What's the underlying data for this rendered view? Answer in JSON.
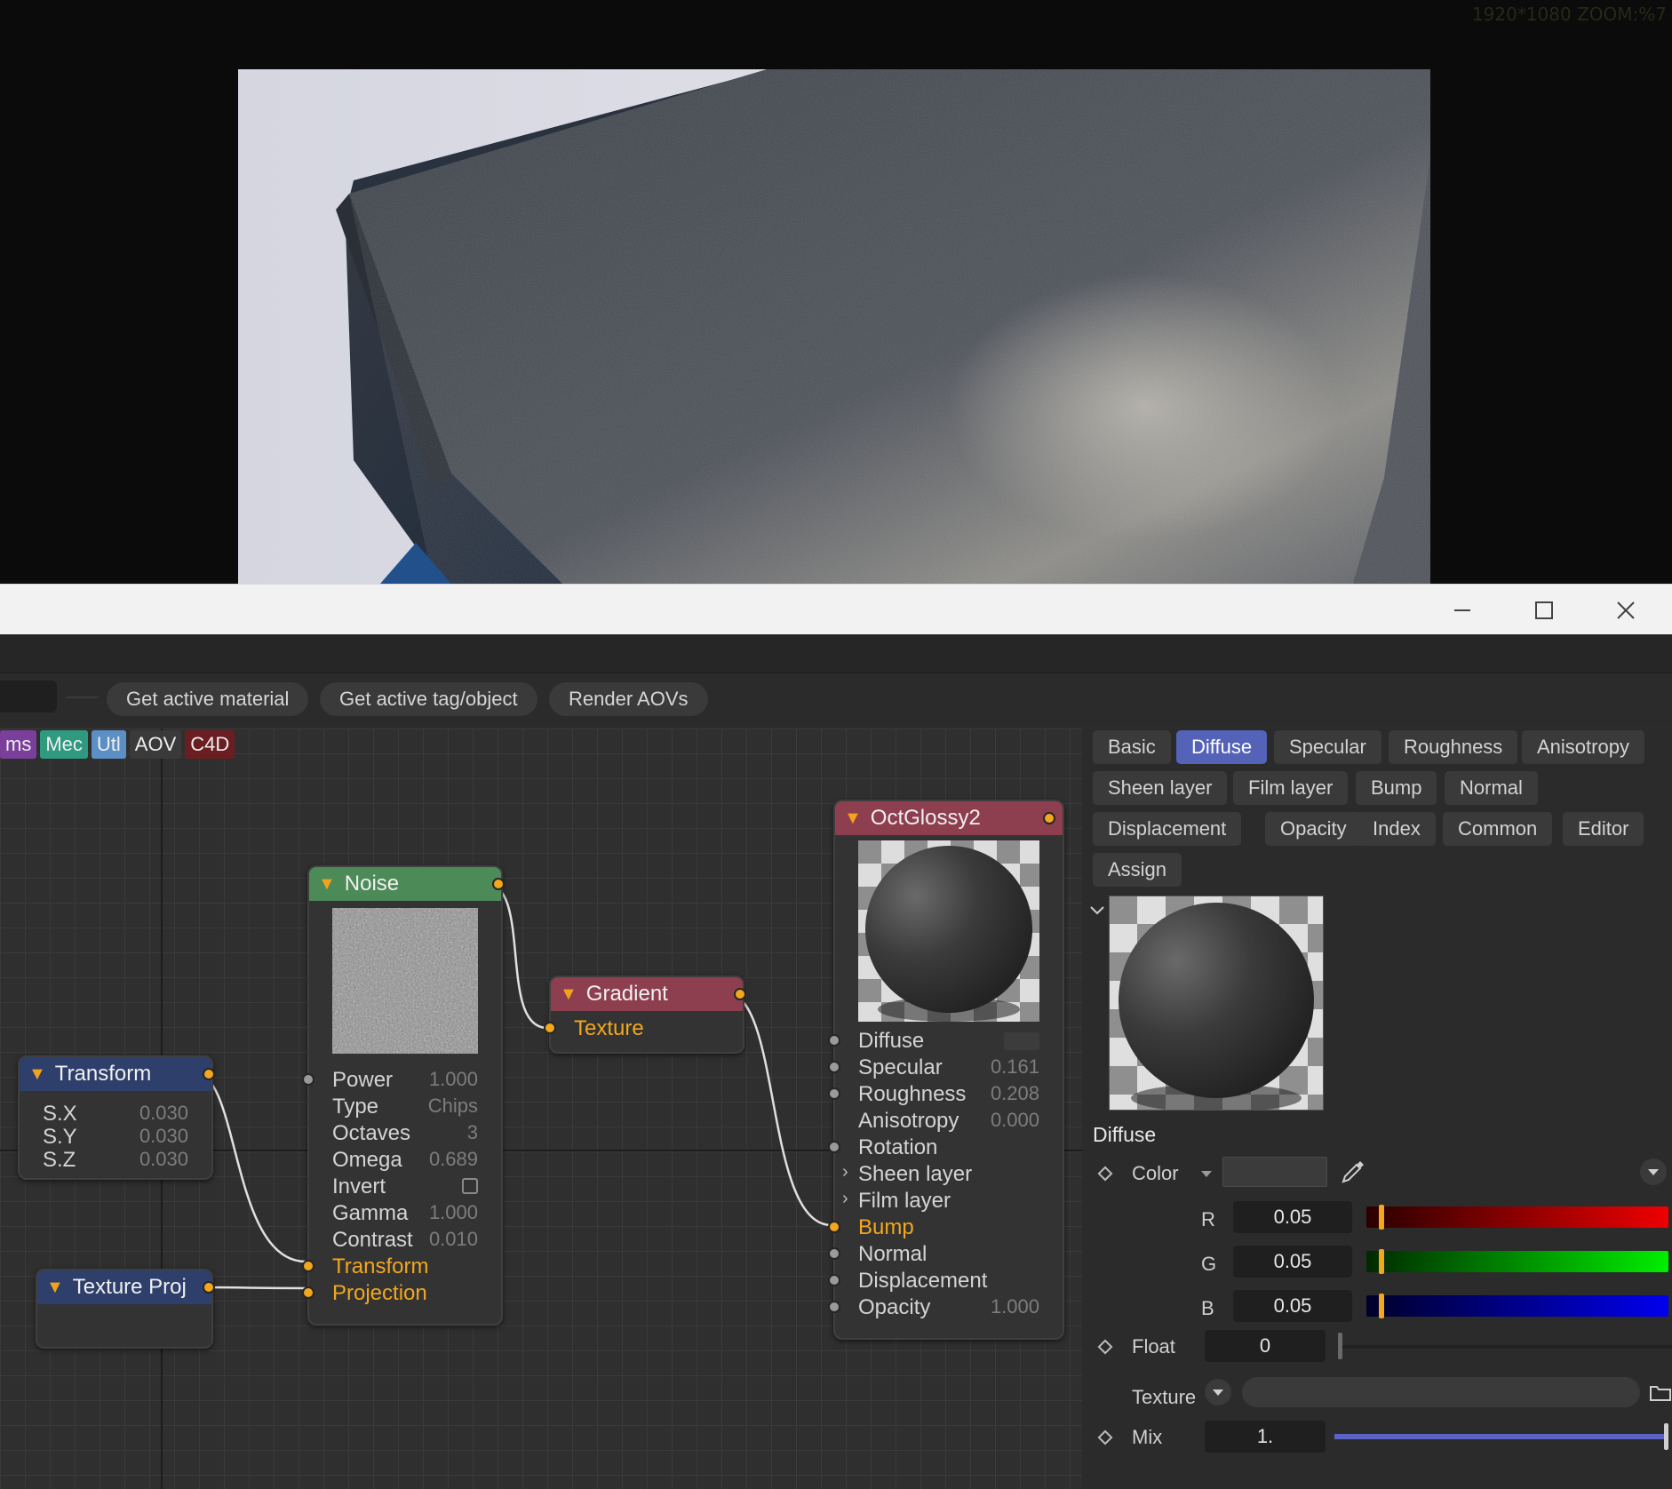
{
  "viewport": {
    "zoom_label": "1920*1080 ZOOM:%7"
  },
  "window": {
    "minimize": "—",
    "maximize": "☐",
    "close": "✕"
  },
  "toolbar": {
    "get_active_material": "Get active material",
    "get_active_tag": "Get active tag/object",
    "render_aovs": "Render AOVs"
  },
  "category_tags": [
    {
      "label": "ms",
      "color": "#7a3f9a"
    },
    {
      "label": "Mec",
      "color": "#2f9a80"
    },
    {
      "label": "Utl",
      "color": "#5c8fc4"
    },
    {
      "label": "AOV",
      "color": "#3a3a3a"
    },
    {
      "label": "C4D",
      "color": "#6b1e22"
    }
  ],
  "nodes": {
    "transform": {
      "title": "Transform",
      "color": "#2e3f6b",
      "params": [
        {
          "label": "S.X",
          "value": "0.030"
        },
        {
          "label": "S.Y",
          "value": "0.030"
        },
        {
          "label": "S.Z",
          "value": "0.030"
        }
      ]
    },
    "texture_proj": {
      "title": "Texture Proj",
      "color": "#2e3f6b"
    },
    "noise": {
      "title": "Noise",
      "color": "#4c8b57",
      "params": [
        {
          "label": "Power",
          "value": "1.000"
        },
        {
          "label": "Type",
          "value": "Chips"
        },
        {
          "label": "Octaves",
          "value": "3"
        },
        {
          "label": "Omega",
          "value": "0.689"
        },
        {
          "label": "Invert",
          "value": ""
        },
        {
          "label": "Gamma",
          "value": "1.000"
        },
        {
          "label": "Contrast",
          "value": "0.010"
        }
      ],
      "inputs": [
        "Transform",
        "Projection"
      ]
    },
    "gradient": {
      "title": "Gradient",
      "color": "#8e3f4f",
      "input": "Texture"
    },
    "octglossy": {
      "title": "OctGlossy2",
      "color": "#8e3f4f",
      "params": [
        {
          "label": "Diffuse",
          "value": ""
        },
        {
          "label": "Specular",
          "value": "0.161"
        },
        {
          "label": "Roughness",
          "value": "0.208"
        },
        {
          "label": "Anisotropy",
          "value": "0.000"
        },
        {
          "label": "Rotation",
          "value": ""
        },
        {
          "label": "Sheen layer",
          "value": ""
        },
        {
          "label": "Film layer",
          "value": ""
        },
        {
          "label": "Bump",
          "value": ""
        },
        {
          "label": "Normal",
          "value": ""
        },
        {
          "label": "Displacement",
          "value": ""
        },
        {
          "label": "Opacity",
          "value": "1.000"
        }
      ]
    }
  },
  "panel": {
    "tabs": [
      {
        "label": "Basic",
        "active": false
      },
      {
        "label": "Diffuse",
        "active": true
      },
      {
        "label": "Specular",
        "active": false
      },
      {
        "label": "Roughness",
        "active": false
      },
      {
        "label": "Anisotropy",
        "active": false
      },
      {
        "label": "Sheen layer",
        "active": false
      },
      {
        "label": "Film layer",
        "active": false
      },
      {
        "label": "Bump",
        "active": false
      },
      {
        "label": "Normal",
        "active": false
      },
      {
        "label": "Displacement",
        "active": false
      },
      {
        "label": "Opacity",
        "active": false
      },
      {
        "label": "Index",
        "active": false
      },
      {
        "label": "Common",
        "active": false
      },
      {
        "label": "Editor",
        "active": false
      },
      {
        "label": "Assign",
        "active": false
      }
    ],
    "section_title": "Diffuse",
    "color_label": "Color",
    "r_label": "R",
    "r_value": "0.05",
    "g_label": "G",
    "g_value": "0.05",
    "b_label": "B",
    "b_value": "0.05",
    "float_label": "Float",
    "float_value": "0",
    "texture_label": "Texture",
    "mix_label": "Mix",
    "mix_value": "1.",
    "mix_level": 1.0,
    "color_level": 0.05
  }
}
